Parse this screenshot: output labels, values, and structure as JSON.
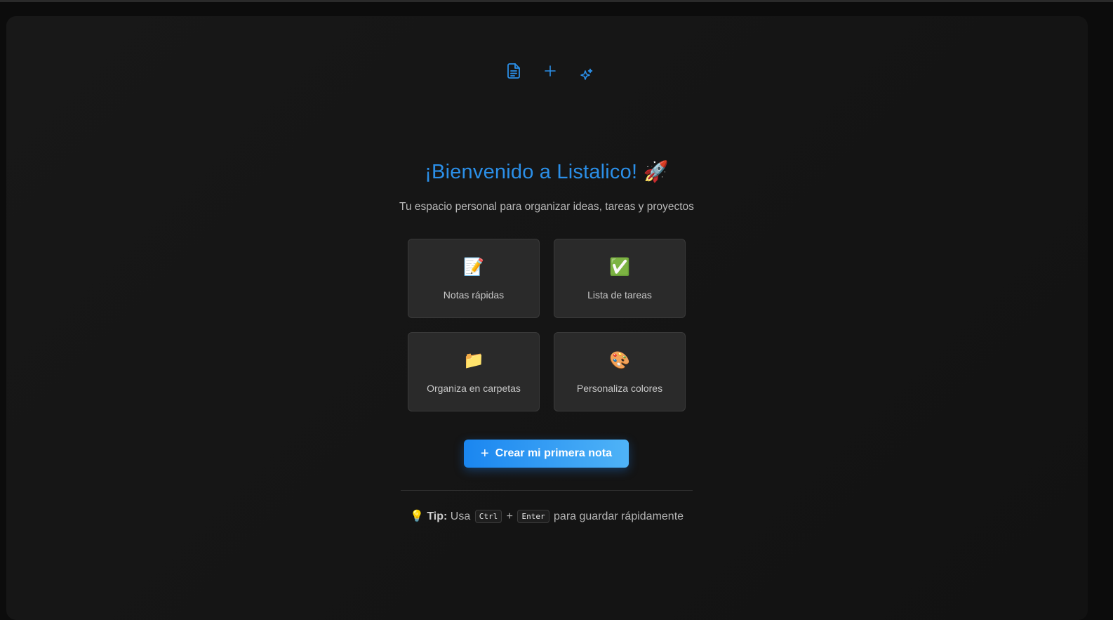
{
  "top_icons": [
    "file-text-icon",
    "plus-icon",
    "sparkles-icon"
  ],
  "welcome": {
    "title": "¡Bienvenido a Listalico!",
    "title_emoji": "🚀",
    "subtitle": "Tu espacio personal para organizar ideas, tareas y proyectos"
  },
  "features": [
    {
      "icon": "📝",
      "label": "Notas rápidas"
    },
    {
      "icon": "✅",
      "label": "Lista de tareas"
    },
    {
      "icon": "📁",
      "label": "Organiza en carpetas"
    },
    {
      "icon": "🎨",
      "label": "Personaliza colores"
    }
  ],
  "cta": {
    "icon": "+",
    "label": "Crear mi primera nota"
  },
  "tip": {
    "icon": "💡",
    "label": "Tip:",
    "text_before": "Usa",
    "key1": "Ctrl",
    "plus": "+",
    "key2": "Enter",
    "text_after": "para guardar rápidamente"
  },
  "colors": {
    "accent": "#2b8fe8",
    "button_start": "#1a86f0",
    "button_end": "#4fb3f7",
    "background": "#141414",
    "card": "#2a2a2a"
  }
}
